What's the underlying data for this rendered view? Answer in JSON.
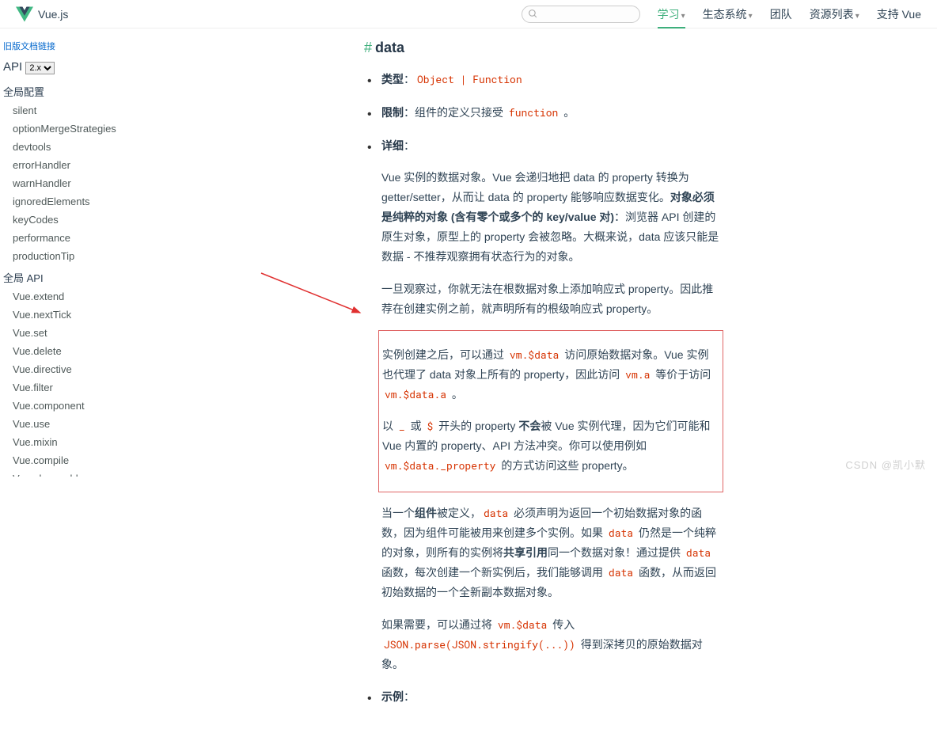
{
  "header": {
    "brand": "Vue.js",
    "search_placeholder": "",
    "nav": [
      {
        "label": "学习",
        "dropdown": true,
        "active": true
      },
      {
        "label": "生态系统",
        "dropdown": true,
        "active": false
      },
      {
        "label": "团队",
        "dropdown": false,
        "active": false
      },
      {
        "label": "资源列表",
        "dropdown": true,
        "active": false
      },
      {
        "label": "支持 Vue",
        "dropdown": false,
        "active": false
      }
    ]
  },
  "sidebar": {
    "old_link": "旧版文档链接",
    "title": "API",
    "version": "2.x",
    "sections": [
      {
        "header": "全局配置",
        "items": [
          "silent",
          "optionMergeStrategies",
          "devtools",
          "errorHandler",
          "warnHandler",
          "ignoredElements",
          "keyCodes",
          "performance",
          "productionTip"
        ]
      },
      {
        "header": "全局 API",
        "items": [
          "Vue.extend",
          "Vue.nextTick",
          "Vue.set",
          "Vue.delete",
          "Vue.directive",
          "Vue.filter",
          "Vue.component",
          "Vue.use",
          "Vue.mixin",
          "Vue.compile",
          "Vue.observable"
        ]
      }
    ]
  },
  "content": {
    "hash": "#",
    "title": "data",
    "bullets": {
      "type_label": "类型",
      "type_code": "Object | Function",
      "restrict_label": "限制",
      "restrict_text": "：组件的定义只接受 ",
      "restrict_code": "function",
      "restrict_end": " 。",
      "detail_label": "详细",
      "p1_a": "Vue 实例的数据对象。Vue 会递归地把 data 的 property 转换为 getter/setter，从而让 data 的 property 能够响应数据变化。",
      "p1_b": "对象必须是纯粹的对象 (含有零个或多个的 key/value 对)",
      "p1_c": "：浏览器 API 创建的原生对象，原型上的 property 会被忽略。大概来说，data 应该只能是数据 - 不推荐观察拥有状态行为的对象。",
      "p2": "一旦观察过，你就无法在根数据对象上添加响应式 property。因此推荐在创建实例之前，就声明所有的根级响应式 property。",
      "p3_a": "实例创建之后，可以通过 ",
      "p3_code1": "vm.$data",
      "p3_b": " 访问原始数据对象。Vue 实例也代理了 data 对象上所有的 property，因此访问 ",
      "p3_code2": "vm.a",
      "p3_c": " 等价于访问 ",
      "p3_code3": "vm.$data.a",
      "p3_d": " 。",
      "p4_a": "以 ",
      "p4_code1": "_",
      "p4_b": " 或 ",
      "p4_code2": "$",
      "p4_c": " 开头的 property ",
      "p4_bold": "不会",
      "p4_d": "被 Vue 实例代理，因为它们可能和 Vue 内置的 property、API 方法冲突。你可以使用例如 ",
      "p4_code3": "vm.$data._property",
      "p4_e": " 的方式访问这些 property。",
      "p5_a": "当一个",
      "p5_bold": "组件",
      "p5_b": "被定义，",
      "p5_code1": "data",
      "p5_c": " 必须声明为返回一个初始数据对象的函数，因为组件可能被用来创建多个实例。如果 ",
      "p5_code2": "data",
      "p5_d": " 仍然是一个纯粹的对象，则所有的实例将",
      "p5_bold2": "共享引用",
      "p5_e": "同一个数据对象！通过提供 ",
      "p5_code3": "data",
      "p5_f": " 函数，每次创建一个新实例后，我们能够调用 ",
      "p5_code4": "data",
      "p5_g": " 函数，从而返回初始数据的一个全新副本数据对象。",
      "p6_a": "如果需要，可以通过将 ",
      "p6_code1": "vm.$data",
      "p6_b": " 传入 ",
      "p6_code2": "JSON.parse(JSON.stringify(...))",
      "p6_c": " 得到深拷贝的原始数据对象。",
      "example_label": "示例"
    }
  },
  "watermark": "CSDN @凯小默"
}
